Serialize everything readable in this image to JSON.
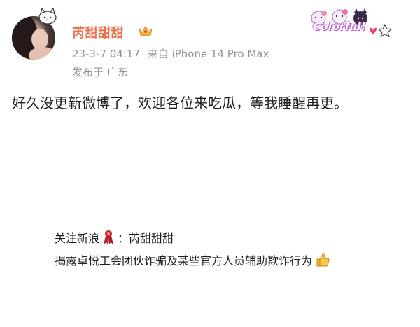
{
  "post": {
    "username": "芮甜甜甜",
    "timestamp": "23-3-7 04:17",
    "source": "来自 iPhone 14 Pro Max",
    "location": "发布于 广东",
    "badge_text": "Colorful!",
    "content": "好久没更新微博了，欢迎各位来吃瓜，等我睡醒再更。",
    "icons": {
      "crown": "crown-icon",
      "badge": "hello-kitty-colorful-badge",
      "follow": "star-outline-icon",
      "ribbon": "red-ribbon-icon",
      "thumb": "thumbs-up-icon"
    }
  },
  "caption": {
    "line1_prefix": "关注新浪",
    "line1_suffix": "：芮甜甜甜",
    "line2": "揭露卓悦工会团伙诈骗及某些官方人员辅助欺诈行为"
  },
  "colors": {
    "username": "#eb7350",
    "meta": "#939393",
    "text": "#1e1e1e"
  }
}
